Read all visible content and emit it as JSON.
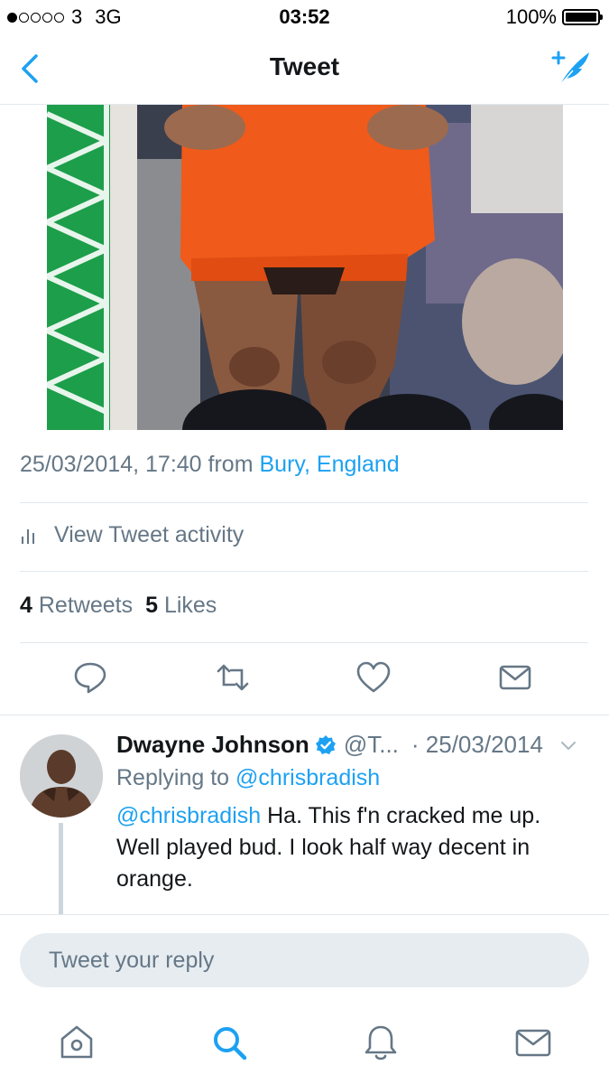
{
  "status_bar": {
    "carrier": "3",
    "network": "3G",
    "time": "03:52",
    "battery": "100%",
    "battery_level": 1.0
  },
  "nav": {
    "title": "Tweet",
    "back_icon": "chevron-left-icon",
    "compose_icon": "compose-tweet-icon"
  },
  "tweet": {
    "meta_datetime": "25/03/2014, 17:40 from",
    "meta_location": "Bury, England",
    "activity_label": "View Tweet activity",
    "retweets_count": "4",
    "retweets_label": "Retweets",
    "likes_count": "5",
    "likes_label": "Likes",
    "actions": [
      "reply-icon",
      "retweet-icon",
      "like-icon",
      "share-icon"
    ]
  },
  "reply": {
    "name": "Dwayne Johnson",
    "handle": "@T...",
    "date": "· 25/03/2014",
    "replying_prefix": "Replying to",
    "replying_to": "@chrisbradish",
    "mention": "@chrisbradish",
    "text": "Ha. This f'n cracked me up. Well played bud. I look half way decent in orange."
  },
  "reply_box": {
    "placeholder": "Tweet your reply"
  },
  "tabs": [
    "home-icon",
    "search-icon",
    "notifications-icon",
    "messages-icon"
  ],
  "colors": {
    "accent": "#1da1f2",
    "secondary_text": "#657786",
    "divider": "#e1e8ed"
  }
}
